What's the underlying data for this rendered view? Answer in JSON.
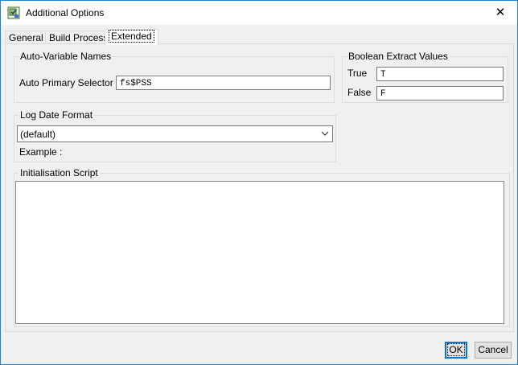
{
  "window": {
    "title": "Additional Options",
    "close_glyph": "✕"
  },
  "tabs": [
    {
      "label": "General",
      "active": false
    },
    {
      "label": "Build Process",
      "active": false
    },
    {
      "label": "Extended",
      "active": true
    }
  ],
  "auto_variable": {
    "group_label": "Auto-Variable Names",
    "primary_selector_label": "Auto Primary Selector",
    "primary_selector_value": "fs$PSS"
  },
  "boolean_extract": {
    "group_label": "Boolean Extract Values",
    "true_label": "True",
    "true_value": "T",
    "false_label": "False",
    "false_value": "F"
  },
  "log_date": {
    "group_label": "Log Date Format",
    "selected": "(default)",
    "example_label": "Example :"
  },
  "init_script": {
    "group_label": "Initialisation Script",
    "value": ""
  },
  "buttons": {
    "ok": "OK",
    "cancel": "Cancel"
  },
  "colors": {
    "accent": "#0078d7",
    "window_border": "#1883d7",
    "face": "#f0f0f0"
  }
}
